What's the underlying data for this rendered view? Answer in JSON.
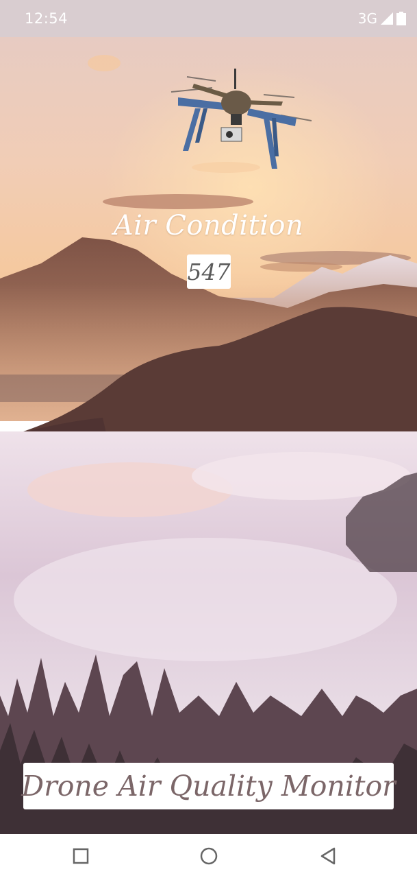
{
  "status_bar": {
    "time": "12:54",
    "network": "3G",
    "signal_icon": "signal-icon",
    "battery_icon": "battery-icon"
  },
  "main": {
    "title": "Air Condition",
    "reading": "547",
    "banner": "Drone Air Quality Monitor",
    "drone_icon": "drone-image",
    "background": "mountain-forest-fog-landscape"
  },
  "nav_bar": {
    "recents_icon": "square-icon",
    "home_icon": "circle-icon",
    "back_icon": "triangle-back-icon"
  },
  "colors": {
    "sky_top": "#e9cfc3",
    "sky_glow": "#f6c79a",
    "mountain": "#8a5d4f",
    "forest": "#5a3b35",
    "fog": "#e8d9e3",
    "banner_text": "#7b6668",
    "reading_text": "#5a5a5a"
  }
}
